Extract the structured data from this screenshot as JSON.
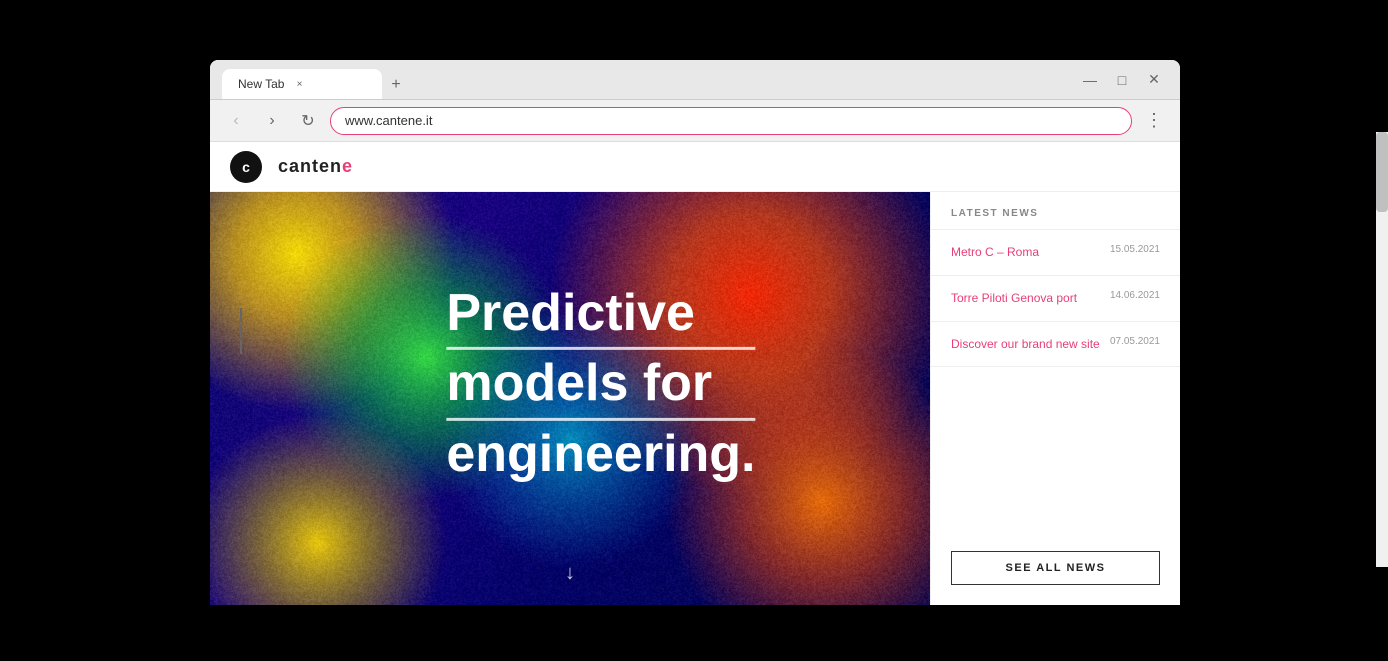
{
  "browser": {
    "tab_title": "New Tab",
    "tab_close_label": "×",
    "new_tab_label": "+",
    "url": "www.cantene.it",
    "back_label": "‹",
    "forward_label": "›",
    "reload_label": "↻",
    "menu_label": "⋮",
    "minimize_label": "—",
    "maximize_label": "□",
    "close_label": "✕"
  },
  "site": {
    "logo_letter": "c",
    "logo_text": "cantene",
    "hero": {
      "line1": "Predictive",
      "line2": "models for",
      "line3": "engineering."
    },
    "scroll_icon": "↓",
    "sidebar": {
      "news_label": "LATEST NEWS",
      "items": [
        {
          "title": "Metro C – Roma",
          "date": "15.05.2021"
        },
        {
          "title": "Torre Piloti Genova port",
          "date": "14.06.2021"
        },
        {
          "title": "Discover our brand new site",
          "date": "07.05.2021"
        }
      ],
      "see_all_label": "SEE ALL NEWS"
    }
  }
}
